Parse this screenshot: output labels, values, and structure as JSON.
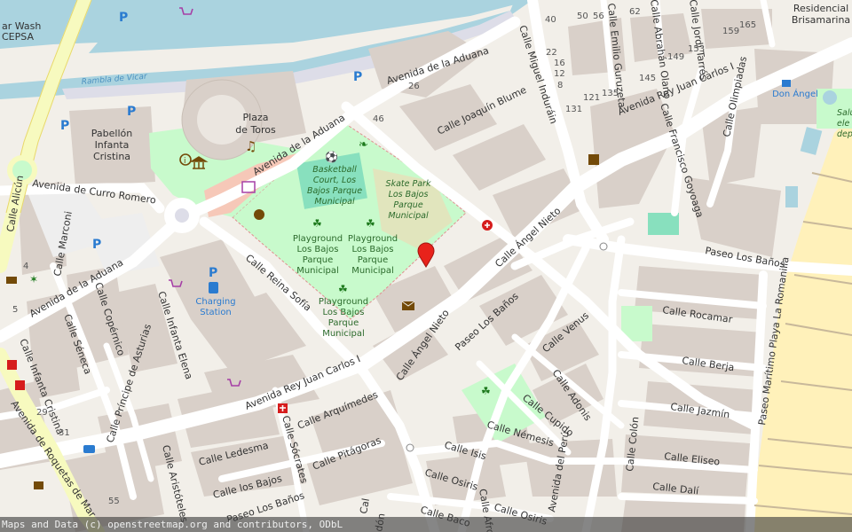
{
  "attribution": "Maps and Data (c) openstreetmap.org and contributors, ODbL",
  "colors": {
    "water": "#aad3df",
    "road": "#ffffff",
    "primary_road": "#f7fabf",
    "building": "#d9d0c9",
    "park": "#c8facc",
    "beach": "#fff1ba",
    "pitch": "#88e0be",
    "marker": "#e8221b"
  },
  "streets": {
    "avenida_aduana_top": "Avenida de la Aduana",
    "avenida_aduana_mid": "Avenida de la Aduana",
    "avenida_aduana_left": "Avenida de la Aduana",
    "calle_miguel_indurain": "Calle Miguel Induráin",
    "calle_emilio_guruzeta": "Calle Emilio Guruzeta",
    "calle_abrahan_olano": "Calle Abrahán Olano",
    "calle_jordi_tarres": "Calle Jordi Tarrés",
    "calle_joaquin_blume": "Calle Joaquín Blume",
    "avenida_rey_juan_carlos_top": "Avenida Rey Juan Carlos I",
    "avenida_rey_juan_carlos_bottom": "Avenida Rey Juan Carlos I",
    "calle_olimpiadas": "Calle Olimpiadas",
    "calle_francisco_goyoaga": "Calle Francisco Goyoaga",
    "avenida_curro_romero": "Avenida de Curro Romero",
    "calle_alicun": "Calle Alicún",
    "calle_marconi": "Calle Marconi",
    "calle_reina_sofia": "Calle Reina Sofía",
    "calle_angel_nieto_top": "Calle Ángel Nieto",
    "calle_angel_nieto_bottom": "Calle Ángel Nieto",
    "paseo_los_banos_right": "Paseo Los Baños",
    "paseo_los_banos_mid": "Paseo Los Baños",
    "paseo_los_banos_bottom": "Paseo Los Baños",
    "calle_rocamar": "Calle Rocamar",
    "calle_berja": "Calle Berja",
    "calle_jazmin": "Calle Jazmín",
    "calle_eliseo": "Calle Eliseo",
    "calle_dali": "Calle Dalí",
    "calle_colon": "Calle Colón",
    "calle_venus": "Calle Venus",
    "calle_adonis": "Calle Adonis",
    "calle_cupido": "Calle Cupido",
    "calle_nemesis": "Calle Némesis",
    "calle_isis": "Calle Isis",
    "calle_osiris_a": "Calle Osiris",
    "calle_osiris_b": "Calle Osiris",
    "calle_baco": "Calle Baco",
    "calle_afrodita": "Calle Afrodita",
    "avenida_del_peru": "Avenida del Perú",
    "calle_copernico": "Calle Copérnico",
    "calle_seneca": "Calle Séneca",
    "calle_infanta_cristina": "Calle Infanta Cristina",
    "calle_principe_asturias": "Calle Príncipe de Asturias",
    "calle_infanta_elena": "Calle Infanta Elena",
    "calle_arquimedes": "Calle Arquímedes",
    "calle_pitagoras": "Calle Pitágoras",
    "calle_socrates": "Calle Sócrates",
    "calle_ledesma": "Calle Ledesma",
    "calle_los_bajos": "Calle los Bajos",
    "calle_aristoteles": "Calle Aristóteles",
    "avenida_roquetas": "Avenida de Roquetas de Mar",
    "paseo_maritimo": "Paseo Marítimo Playa La Romanilla",
    "cal_fragment": "Cal",
    "don_fragment": "dón"
  },
  "places": {
    "plaza_toros": [
      "Plaza",
      "de Toros"
    ],
    "pabellon": [
      "Pabellón",
      "Infanta",
      "Cristina"
    ],
    "basketball": [
      "Basketball",
      "Court, Los",
      "Bajos Parque",
      "Municipal"
    ],
    "skate_park": [
      "Skate Park",
      "Los Bajos",
      "Parque",
      "Municipal"
    ],
    "playground_1": [
      "Playground",
      "Los Bajos",
      "Parque",
      "Municipal"
    ],
    "playground_2": [
      "Playground",
      "Los Bajos",
      "Parque",
      "Municipal"
    ],
    "playground_3": [
      "Playground",
      "Los Bajos",
      "Parque",
      "Municipal"
    ],
    "charging": [
      "Charging",
      "Station"
    ],
    "don_angel": "Don Ángel",
    "residencial": [
      "Residencial",
      "Brisamarina"
    ],
    "car_wash": [
      "ar Wash",
      "CEPSA"
    ],
    "rambla": "Rambla de Vicar",
    "sea_text": [
      "Salu",
      "ele",
      "depo"
    ]
  },
  "house_numbers": [
    "40",
    "50",
    "56",
    "62",
    "26",
    "46",
    "22",
    "16",
    "12",
    "8",
    "121",
    "131",
    "135",
    "145",
    "149",
    "153",
    "159",
    "165",
    "4",
    "5",
    "29",
    "31",
    "55"
  ],
  "icons": [
    "parking-icon",
    "shopping-cart-icon",
    "info-icon",
    "museum-icon",
    "music-icon",
    "theatre-icon",
    "playground-icon",
    "pet-icon",
    "pharmacy-icon",
    "post-office-icon",
    "charging-station-icon",
    "hotel-icon",
    "taxi-icon",
    "fitness-icon",
    "sport-icon",
    "map-pin-icon"
  ]
}
